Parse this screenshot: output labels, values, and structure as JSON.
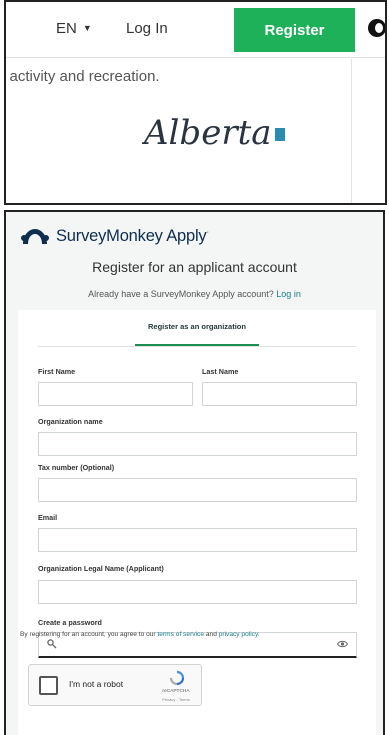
{
  "top_nav": {
    "language": "EN",
    "login_label": "Log In",
    "register_label": "Register",
    "register_color": "#1fb15a"
  },
  "banner": {
    "tagline": "l activity and recreation.",
    "logo_text": "Alberta"
  },
  "header": {
    "brand_name": "SurveyMonkey Apply",
    "title": "Register for an applicant account",
    "already_text": "Already have a SurveyMonkey Apply account?",
    "login_link": "Log in",
    "link_color": "#1a7f8c"
  },
  "form": {
    "tab_label": "Register as an organization",
    "fields": {
      "first_name": {
        "label": "First Name",
        "value": ""
      },
      "last_name": {
        "label": "Last Name",
        "value": ""
      },
      "organization_name": {
        "label": "Organization name",
        "value": ""
      },
      "tax_number": {
        "label": "Tax number (Optional)",
        "value": ""
      },
      "email": {
        "label": "Email",
        "value": ""
      },
      "org_legal_name": {
        "label": "Organization Legal Name (Applicant)",
        "value": ""
      },
      "password": {
        "label": "Create a password",
        "value": ""
      }
    },
    "terms": {
      "prefix": "By registering for an account, you agree to our",
      "terms_link": "terms of service",
      "and": "and",
      "privacy_link": "privacy policy."
    },
    "recaptcha": {
      "label": "I'm not a robot",
      "brand": "reCAPTCHA",
      "links": "Privacy - Terms"
    }
  },
  "icons": [
    "chevron-down-icon",
    "edge-browser-icon",
    "alberta-logo",
    "surveymonkey-logo-icon",
    "key-icon",
    "eye-icon",
    "recaptcha-logo-icon"
  ]
}
